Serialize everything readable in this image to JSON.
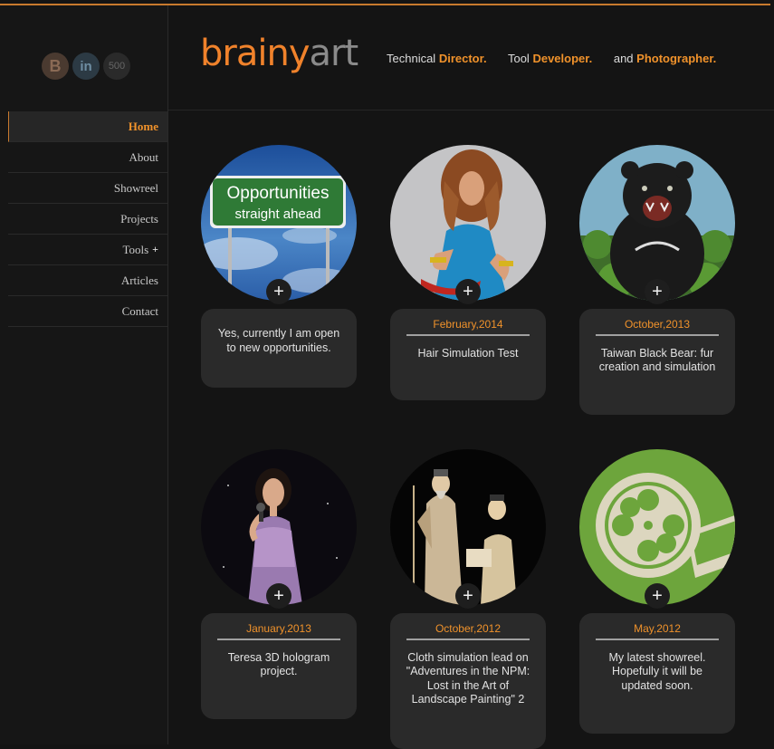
{
  "brand": {
    "logo_part1": "brainy",
    "logo_part2": "art"
  },
  "tagline": [
    {
      "prefix": "Technical",
      "highlight": "Director."
    },
    {
      "prefix": "Tool",
      "highlight": "Developer."
    },
    {
      "prefix": "and",
      "highlight": "Photographer."
    }
  ],
  "social": {
    "blogger": "B",
    "linkedin": "in",
    "px500": "500"
  },
  "nav": [
    {
      "label": "Home",
      "active": true
    },
    {
      "label": "About"
    },
    {
      "label": "Showreel"
    },
    {
      "label": "Projects"
    },
    {
      "label": "Tools",
      "has_submenu": true,
      "submenu_icon": "+"
    },
    {
      "label": "Articles"
    },
    {
      "label": "Contact"
    }
  ],
  "cards": [
    {
      "date": "",
      "text": "Yes, currently I am open to new opportunities.",
      "image": "opportunities-sign",
      "sign_line1": "Opportunities",
      "sign_line2": "straight ahead"
    },
    {
      "date": "February,2014",
      "text": "Hair Simulation Test",
      "image": "curly-hair-woman"
    },
    {
      "date": "October,2013",
      "text": "Taiwan Black Bear: fur creation and simulation",
      "image": "black-bear"
    },
    {
      "date": "January,2013",
      "text": "Teresa 3D hologram project.",
      "image": "singer-hologram"
    },
    {
      "date": "October,2012",
      "text": "Cloth simulation lead on \"Adventures in the NPM: Lost in the Art of Landscape Painting\" 2",
      "image": "ancient-figures"
    },
    {
      "date": "May,2012",
      "text": "My latest showreel. Hopefully it will be updated soon.",
      "image": "film-reel"
    }
  ],
  "plus_icon": "+",
  "colors": {
    "accent": "#f0922b",
    "background": "#141414",
    "card": "#2a2a2a"
  }
}
